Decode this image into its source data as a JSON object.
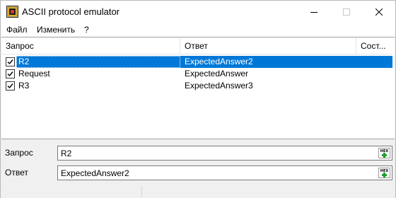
{
  "window": {
    "title": "ASCII protocol emulator",
    "controls": [
      "minimize-icon",
      "maximize-icon",
      "close-icon"
    ]
  },
  "menu": {
    "file": "Файл",
    "edit": "Изменить",
    "help": "?"
  },
  "list": {
    "columns": {
      "request": "Запрос",
      "answer": "Ответ",
      "state": "Сост..."
    },
    "rows": [
      {
        "checked": true,
        "request": "R2",
        "answer": "ExpectedAnswer2",
        "selected": true
      },
      {
        "checked": true,
        "request": "Request",
        "answer": "ExpectedAnswer",
        "selected": false
      },
      {
        "checked": true,
        "request": "R3",
        "answer": "ExpectedAnswer3",
        "selected": false
      }
    ]
  },
  "fields": {
    "request_label": "Запрос",
    "request_value": "R2",
    "answer_label": "Ответ",
    "answer_value": "ExpectedAnswer2",
    "hex_button_label": "HEX"
  },
  "colors": {
    "selection": "#0078d7",
    "hex_plus": "#1e9e2a"
  }
}
